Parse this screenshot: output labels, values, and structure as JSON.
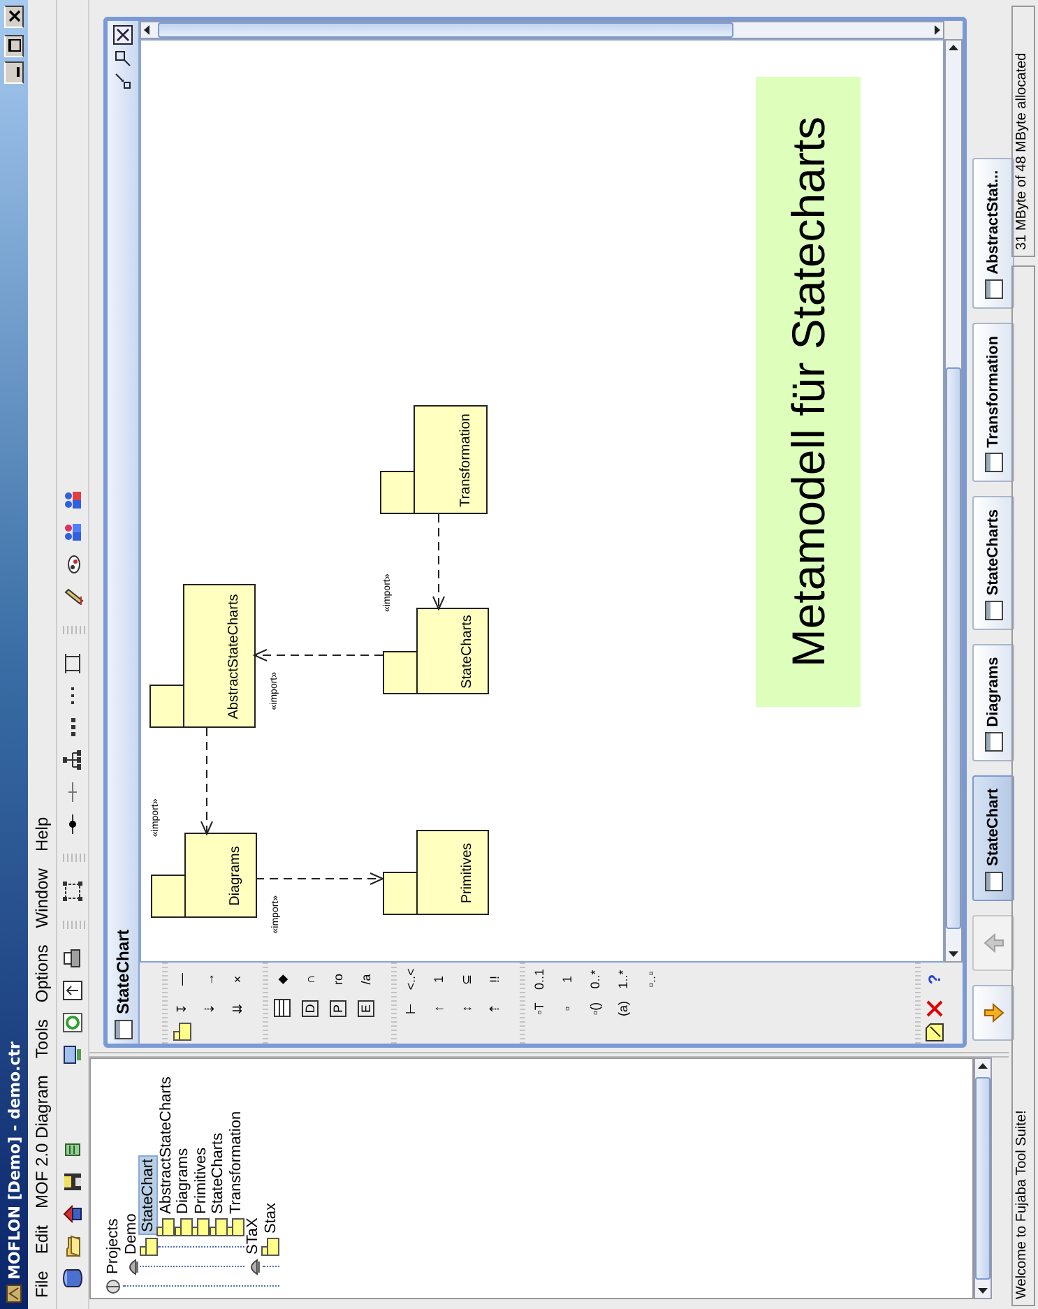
{
  "window": {
    "title": "MOFLON [Demo] - demo.ctr"
  },
  "menu": [
    {
      "label": "File"
    },
    {
      "label": "Edit"
    },
    {
      "label": "MOF 2.0 Diagram"
    },
    {
      "label": "Tools"
    },
    {
      "label": "Options"
    },
    {
      "label": "Window"
    },
    {
      "label": "Help"
    }
  ],
  "tree": [
    {
      "label": "Projects",
      "selected": false,
      "children": [
        {
          "label": "Demo",
          "selected": false,
          "children": [
            {
              "label": "StateChart",
              "selected": true,
              "children": [
                {
                  "label": "AbstractStateCharts",
                  "selected": false
                },
                {
                  "label": "Diagrams",
                  "selected": false
                },
                {
                  "label": "Primitives",
                  "selected": false
                },
                {
                  "label": "StateCharts",
                  "selected": false
                },
                {
                  "label": "Transformation",
                  "selected": false
                }
              ]
            }
          ]
        },
        {
          "label": "STaX",
          "selected": false,
          "children": [
            {
              "label": "Stax",
              "selected": false
            }
          ]
        }
      ]
    }
  ],
  "frame": {
    "title": "StateChart"
  },
  "palette": [
    [
      [
        {
          "kind": "package"
        },
        {
          "kind": "text",
          "text": "↧"
        },
        {
          "kind": "text",
          "text": "—"
        }
      ],
      [
        {
          "kind": "blank"
        },
        {
          "kind": "text",
          "text": "⇣"
        },
        {
          "kind": "text",
          "text": "→"
        }
      ],
      [
        {
          "kind": "blank"
        },
        {
          "kind": "text",
          "text": "⇊"
        },
        {
          "kind": "text",
          "text": "×"
        }
      ]
    ],
    [
      [
        {
          "kind": "blank"
        },
        {
          "kind": "class"
        },
        {
          "kind": "text",
          "text": "◆"
        }
      ],
      [
        {
          "kind": "blank"
        },
        {
          "kind": "boxed",
          "text": "D"
        },
        {
          "kind": "text",
          "text": "∩"
        }
      ],
      [
        {
          "kind": "blank"
        },
        {
          "kind": "boxed",
          "text": "P"
        },
        {
          "kind": "text",
          "text": "ro"
        }
      ],
      [
        {
          "kind": "blank"
        },
        {
          "kind": "boxed",
          "text": "E"
        },
        {
          "kind": "text",
          "text": "/a"
        }
      ]
    ],
    [
      [
        {
          "kind": "blank"
        },
        {
          "kind": "text",
          "text": "⊢"
        },
        {
          "kind": "text",
          "text": "<..<"
        }
      ],
      [
        {
          "kind": "blank"
        },
        {
          "kind": "text",
          "text": "↑"
        },
        {
          "kind": "text",
          "text": "1"
        }
      ],
      [
        {
          "kind": "blank"
        },
        {
          "kind": "text",
          "text": "↕"
        },
        {
          "kind": "text",
          "text": "⊆"
        }
      ],
      [
        {
          "kind": "blank"
        },
        {
          "kind": "text",
          "text": "⇡"
        },
        {
          "kind": "text",
          "text": "!!"
        }
      ]
    ],
    [
      [
        {
          "kind": "blank"
        },
        {
          "kind": "text",
          "text": "▫T"
        },
        {
          "kind": "text",
          "text": "0..1"
        }
      ],
      [
        {
          "kind": "blank"
        },
        {
          "kind": "text",
          "text": "▫"
        },
        {
          "kind": "text",
          "text": "1"
        }
      ],
      [
        {
          "kind": "blank"
        },
        {
          "kind": "text",
          "text": "▫()"
        },
        {
          "kind": "text",
          "text": "0..*"
        }
      ],
      [
        {
          "kind": "blank"
        },
        {
          "kind": "text",
          "text": "(a)"
        },
        {
          "kind": "text",
          "text": "1..*"
        }
      ],
      [
        {
          "kind": "blank"
        },
        {
          "kind": "blank"
        },
        {
          "kind": "text",
          "text": "▫..▫"
        }
      ]
    ],
    [
      [
        {
          "kind": "note"
        },
        {
          "kind": "delete"
        },
        {
          "kind": "help",
          "text": "?"
        }
      ]
    ]
  ],
  "diagram": {
    "packages": [
      {
        "name": "Diagrams"
      },
      {
        "name": "AbstractStateCharts"
      },
      {
        "name": "Primitives"
      },
      {
        "name": "StateCharts"
      },
      {
        "name": "Transformation"
      }
    ],
    "dependencies": [
      {
        "stereotype": "«import»"
      },
      {
        "stereotype": "«import»"
      },
      {
        "stereotype": "«import»"
      },
      {
        "stereotype": "«import»"
      }
    ],
    "note": "Metamodell für Statecharts"
  },
  "tab_nav": [
    {
      "kind": "down",
      "disabled": false
    },
    {
      "kind": "up",
      "disabled": true
    }
  ],
  "tabs": [
    {
      "label": "StateChart",
      "selected": true
    },
    {
      "label": "Diagrams",
      "selected": false
    },
    {
      "label": "StateCharts",
      "selected": false
    },
    {
      "label": "Transformation",
      "selected": false
    },
    {
      "label": "AbstractStat...",
      "selected": false
    }
  ],
  "status_bar": {
    "message": "Welcome to Fujaba Tool Suite!",
    "memory": "31 MByte of 48 MByte allocated"
  }
}
